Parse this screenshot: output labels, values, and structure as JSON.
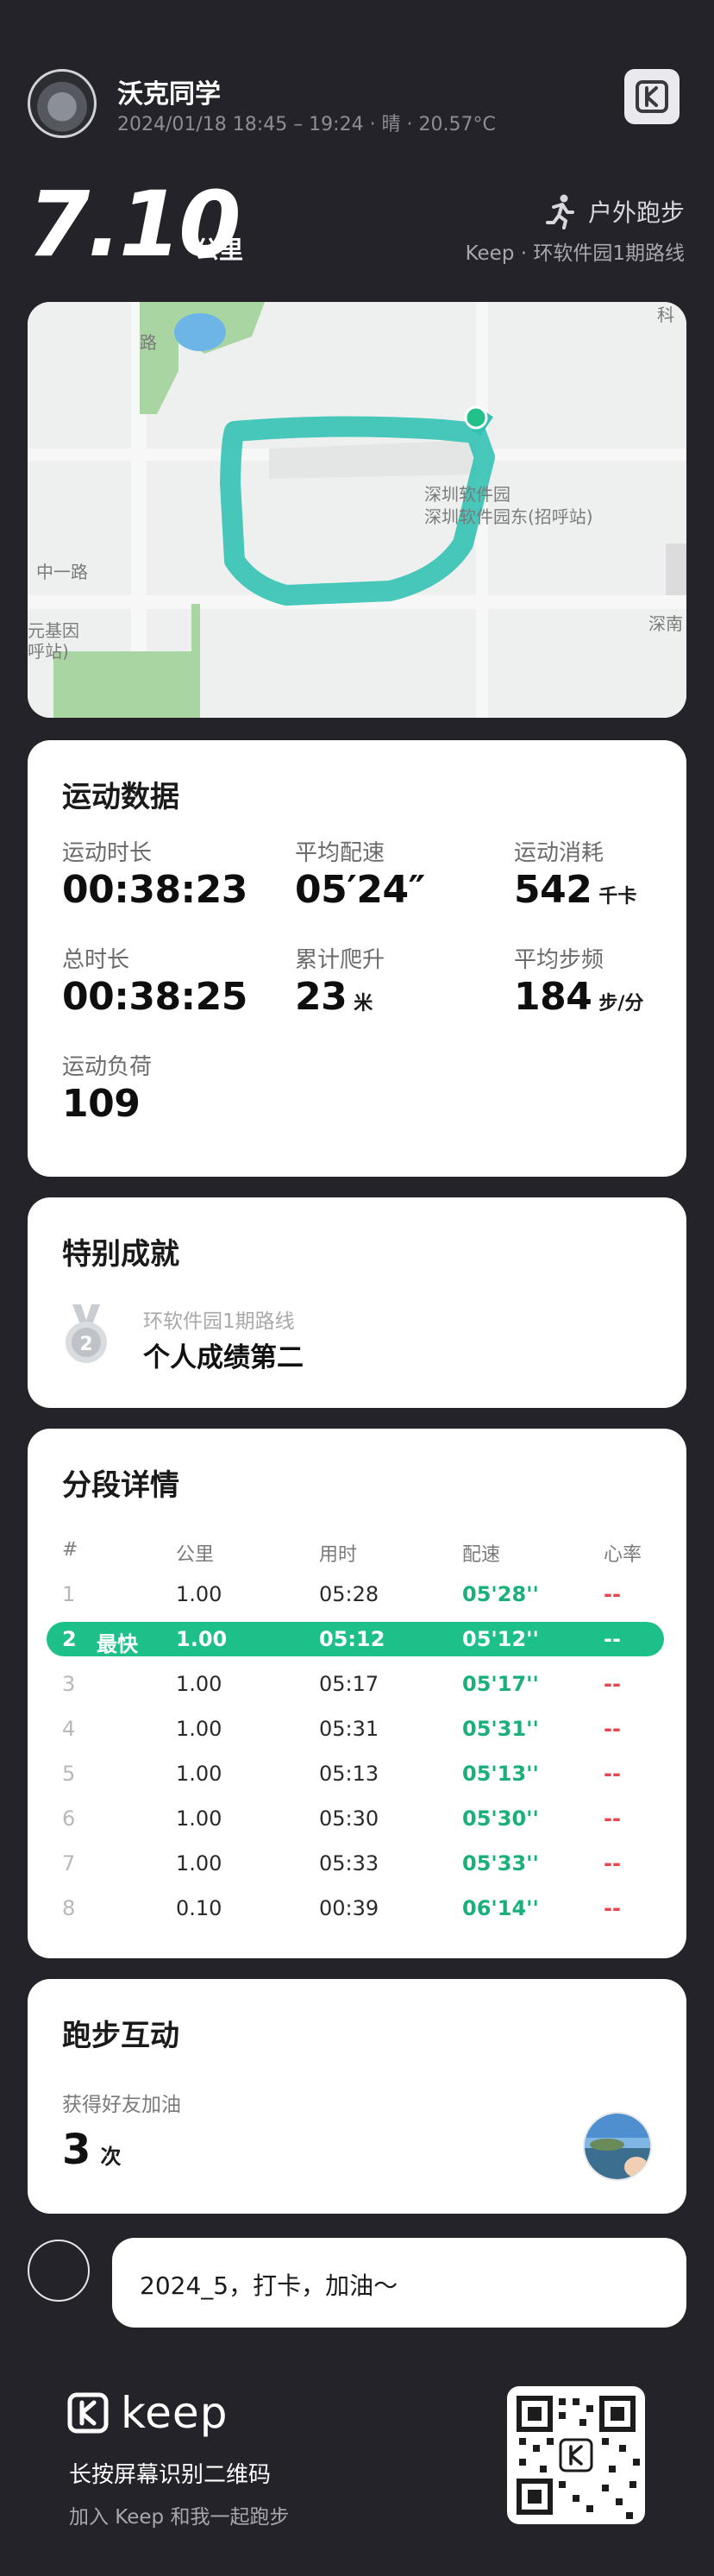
{
  "header": {
    "user_name": "沃克同学",
    "meta": "2024/01/18 18:45 – 19:24 · 晴 · 20.57°C"
  },
  "summary": {
    "distance": "7.10",
    "distance_unit": "公里",
    "sport_type": "户外跑步",
    "route_line": "Keep · 环软件园1期路线"
  },
  "map": {
    "labels": [
      "中一路",
      "深圳软件园",
      "深圳软件园东(招呼站)",
      "科",
      "深南",
      "元基因",
      "呼站)",
      "路"
    ]
  },
  "stats": {
    "title": "运动数据",
    "items": [
      {
        "label": "运动时长",
        "value": "00:38:23",
        "unit": ""
      },
      {
        "label": "平均配速",
        "value": "05′24″",
        "unit": ""
      },
      {
        "label": "运动消耗",
        "value": "542",
        "unit": "千卡"
      },
      {
        "label": "总时长",
        "value": "00:38:25",
        "unit": ""
      },
      {
        "label": "累计爬升",
        "value": "23",
        "unit": "米"
      },
      {
        "label": "平均步频",
        "value": "184",
        "unit": "步/分"
      },
      {
        "label": "运动负荷",
        "value": "109",
        "unit": ""
      }
    ]
  },
  "achievement": {
    "title": "特别成就",
    "medal_rank": "2",
    "route": "环软件园1期路线",
    "text": "个人成绩第二"
  },
  "splits": {
    "title": "分段详情",
    "headers": [
      "#",
      "公里",
      "用时",
      "配速",
      "心率"
    ],
    "best_label": "最快",
    "rows": [
      {
        "idx": "1",
        "km": "1.00",
        "time": "05:28",
        "pace": "05'28''",
        "hr": "--"
      },
      {
        "idx": "2",
        "km": "1.00",
        "time": "05:12",
        "pace": "05'12''",
        "hr": "--"
      },
      {
        "idx": "3",
        "km": "1.00",
        "time": "05:17",
        "pace": "05'17''",
        "hr": "--"
      },
      {
        "idx": "4",
        "km": "1.00",
        "time": "05:31",
        "pace": "05'31''",
        "hr": "--"
      },
      {
        "idx": "5",
        "km": "1.00",
        "time": "05:13",
        "pace": "05'13''",
        "hr": "--"
      },
      {
        "idx": "6",
        "km": "1.00",
        "time": "05:30",
        "pace": "05'30''",
        "hr": "--"
      },
      {
        "idx": "7",
        "km": "1.00",
        "time": "05:33",
        "pace": "05'33''",
        "hr": "--"
      },
      {
        "idx": "8",
        "km": "0.10",
        "time": "00:39",
        "pace": "06'14''",
        "hr": "--"
      }
    ]
  },
  "interaction": {
    "title": "跑步互动",
    "label": "获得好友加油",
    "count": "3",
    "count_unit": "次"
  },
  "comment": {
    "text": "2024_5，打卡，加油～"
  },
  "footer": {
    "brand": "keep",
    "hint_main": "长按屏幕识别二维码",
    "hint_sub": "加入 Keep 和我一起跑步"
  },
  "colors": {
    "background": "#25232a",
    "accent_green": "#1ec08a",
    "heart_rate_red": "#e5474b"
  }
}
